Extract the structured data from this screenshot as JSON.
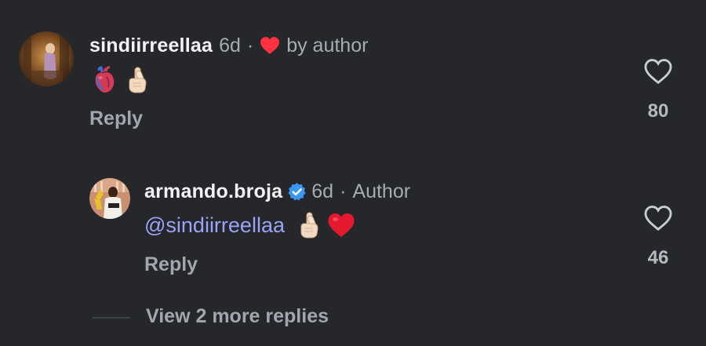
{
  "comment": {
    "username": "sindiirreellaa",
    "time": "6d",
    "separator": "·",
    "liked_by_label": "by author",
    "body_emojis": [
      "anatomical-heart",
      "crossed-fingers"
    ],
    "reply_label": "Reply",
    "like_count": "80",
    "icons": {
      "liked": "red-heart-icon",
      "like": "heart-outline-icon"
    },
    "colors": {
      "heart": "#ff3040"
    }
  },
  "reply": {
    "username": "armando.broja",
    "verified": true,
    "time": "6d",
    "separator": "·",
    "author_label": "Author",
    "mention": "@sindiirreellaa",
    "body_emojis": [
      "crossed-fingers",
      "red-heart"
    ],
    "reply_label": "Reply",
    "like_count": "46",
    "colors": {
      "verified": "#3b97f0",
      "mention": "#9aa4f7"
    }
  },
  "thread": {
    "view_more_label": "View 2 more replies"
  }
}
